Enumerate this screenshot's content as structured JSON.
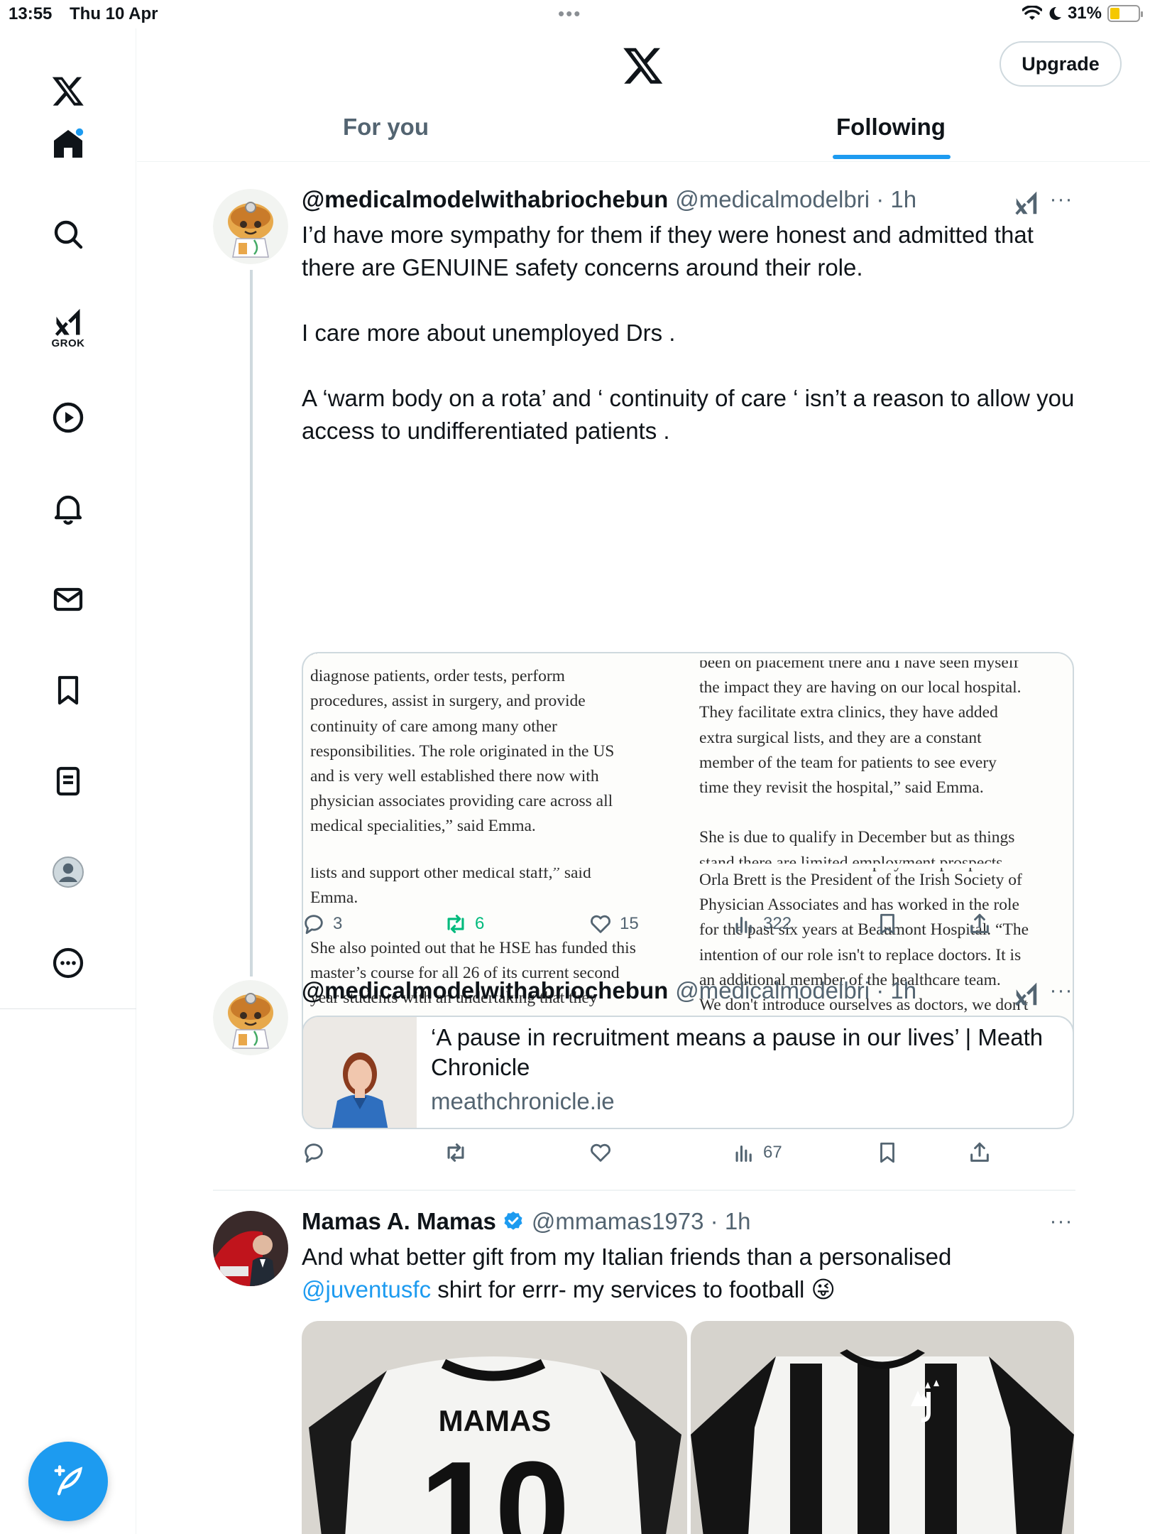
{
  "status_bar": {
    "time": "13:55",
    "date": "Thu 10 Apr",
    "battery": "31%"
  },
  "sidebar": {
    "items": [
      "home-icon",
      "search-icon",
      "grok-icon",
      "video-icon",
      "notifications-icon",
      "messages-icon",
      "bookmarks-icon",
      "lists-icon",
      "profile-icon",
      "more-icon"
    ],
    "grok_label": "GROK"
  },
  "header": {
    "upgrade_label": "Upgrade",
    "tabs": [
      "For you",
      "Following"
    ],
    "active_tab": "Following"
  },
  "colors": {
    "accent": "#1d9bf0",
    "retweet": "#00ba7c",
    "secondary": "#536471"
  },
  "tweets": [
    {
      "name": "@medicalmodelwithabriochebun",
      "handle": "@medicalmodelbri · 1h",
      "text": "I’d have more sympathy for them if they were honest and admitted that there are GENUINE safety concerns around their role.\n\nI care more about unemployed Drs .\n\nA ‘warm body on a rota’ and ‘ continuity of care ‘ isn’t a reason to allow you access to undifferentiated patients .",
      "clipping": {
        "col1_top": "under the supervision of a consultant or GP to\ndiagnose patients, order tests, perform\nprocedures, assist in surgery, and provide\ncontinuity of care among many other\nresponsibilities. The role originated in the US\nand is very well established there now with\nphysician associates providing care across all\nmedical specialities,” said Emma.",
        "col1_bottom": "lists and support other medical staff,” said\nEmma.\n\nShe also pointed out that he HSE has funded this\nmaster’s course for all 26 of its current second\nyear students with an undertaking that they\nwould be employed by the HSE for three years\nafter graduating. She explained that the course\nfees are approximately €24,000 which works out",
        "col2_top": "been on placement there and I have seen myself\nthe impact they are having on our local hospital.\nThey facilitate extra clinics, they have added\nextra surgical lists, and they are a constant\nmember of the team for patients to see every\ntime they revisit the hospital,” said Emma.\n\nShe is due to qualify in December but as things\nstand there are limited employment prospects",
        "col2_bottom": "Orla Brett is the President of the Irish Society of\nPhysician Associates and has worked in the role\nfor the past six years at Beaumont Hospital. “The\nintention of our role isn't to replace doctors. It is\nan additional member of the healthcare team.\nWe don't introduce ourselves as doctors, we don't\nsee ourselves as doctors, our role is a profession\nin its own right.”"
      },
      "replies": "3",
      "reposts": "6",
      "likes": "15",
      "views": "322"
    },
    {
      "name": "@medicalmodelwithabriochebun",
      "handle": "@medicalmodelbri · 1h",
      "card_title": "‘A pause in recruitment means a pause in our lives’ | Meath Chronicle",
      "card_domain": "meathchronicle.ie",
      "views": "67"
    },
    {
      "name": "Mamas A. Mamas",
      "handle": "@mmamas1973 · 1h",
      "text_before": "And what better gift from my Italian friends than a personalised",
      "mention": "@juventusfc",
      "text_after": " shirt for errr- my services to football 😜",
      "shirt_name": "MAMAS",
      "shirt_number": "10"
    }
  ]
}
